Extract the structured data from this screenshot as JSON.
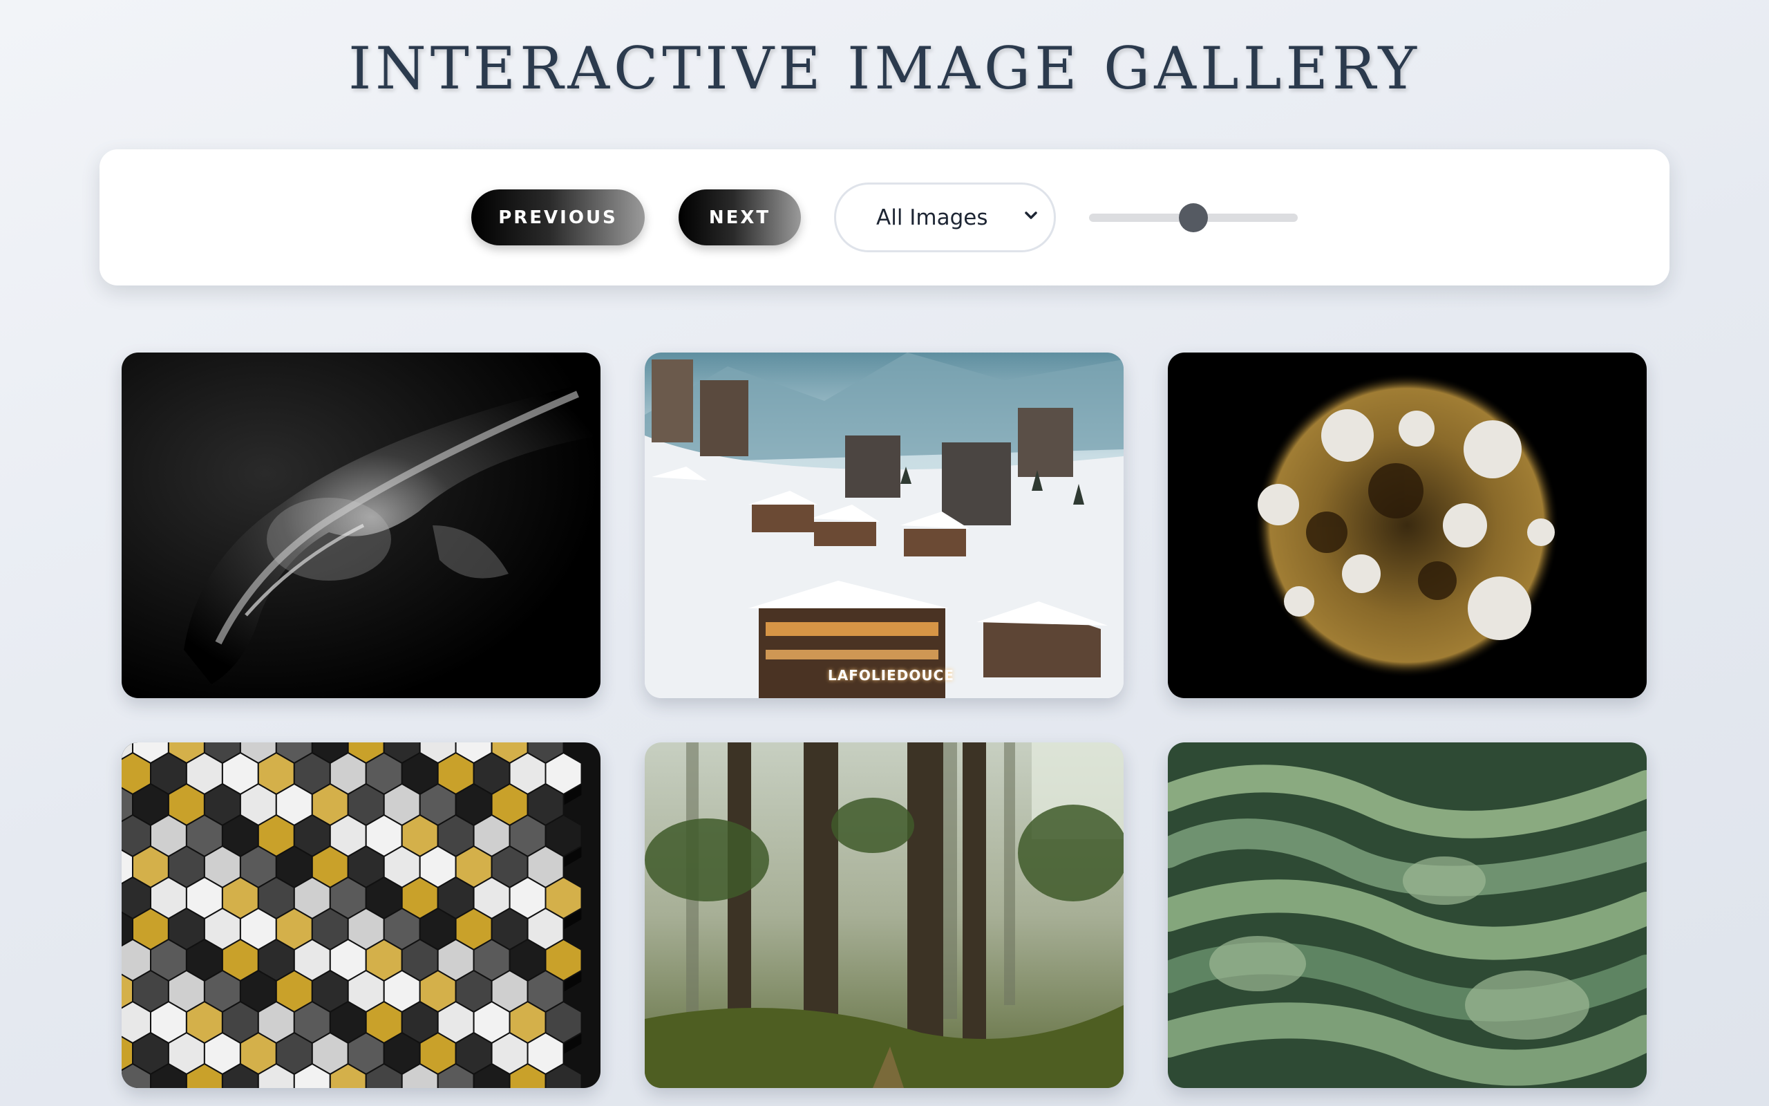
{
  "header": {
    "title": "INTERACTIVE IMAGE GALLERY"
  },
  "controls": {
    "previous_label": "PREVIOUS",
    "next_label": "NEXT",
    "filter": {
      "selected": "All Images"
    },
    "slider": {
      "value_fraction": 0.5
    }
  },
  "gallery": {
    "images": [
      {
        "subject": "night-earth-satellite-view"
      },
      {
        "subject": "snowy-ski-village-at-dusk",
        "sign_text": "LAFOLIEDOUCE"
      },
      {
        "subject": "gold-and-white-particle-sphere"
      },
      {
        "subject": "black-gold-hexagon-pillars"
      },
      {
        "subject": "misty-redwood-forest"
      },
      {
        "subject": "green-ribbon-waves"
      }
    ]
  },
  "colors": {
    "title": "#2b3a4d",
    "button_start": "#000000",
    "button_end": "#9a9a9a",
    "slider_thumb": "#555a62",
    "slider_track": "#dcdde0"
  }
}
